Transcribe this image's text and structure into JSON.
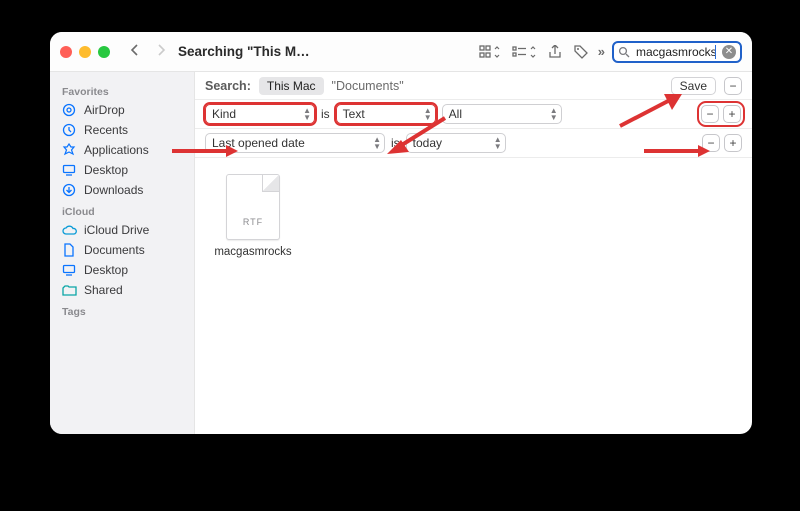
{
  "colors": {
    "accent": "#0a74ff",
    "annotation": "#d33",
    "focus_ring": "#2061c9"
  },
  "toolbar": {
    "title": "Searching \"This M…",
    "search_query": "macgasmrocks"
  },
  "sidebar": {
    "sections": [
      {
        "title": "Favorites",
        "items": [
          {
            "icon": "airdrop-icon",
            "label": "AirDrop"
          },
          {
            "icon": "recents-icon",
            "label": "Recents"
          },
          {
            "icon": "applications-icon",
            "label": "Applications"
          },
          {
            "icon": "desktop-icon",
            "label": "Desktop"
          },
          {
            "icon": "downloads-icon",
            "label": "Downloads"
          }
        ]
      },
      {
        "title": "iCloud",
        "items": [
          {
            "icon": "icloud-icon",
            "label": "iCloud Drive"
          },
          {
            "icon": "documents-icon",
            "label": "Documents"
          },
          {
            "icon": "desktop-icon",
            "label": "Desktop"
          },
          {
            "icon": "shared-icon",
            "label": "Shared"
          }
        ]
      },
      {
        "title": "Tags",
        "items": []
      }
    ]
  },
  "scope": {
    "label": "Search:",
    "active": "This Mac",
    "alternate": "\"Documents\"",
    "save_label": "Save"
  },
  "rules": [
    {
      "field": "Kind",
      "op": "is",
      "value": "Text",
      "extra": "All",
      "highlight": true
    },
    {
      "field": "Last opened date",
      "op": "is",
      "value": "today",
      "highlight": false
    }
  ],
  "results": [
    {
      "name": "macgasmrocks",
      "ext": "RTF"
    }
  ]
}
